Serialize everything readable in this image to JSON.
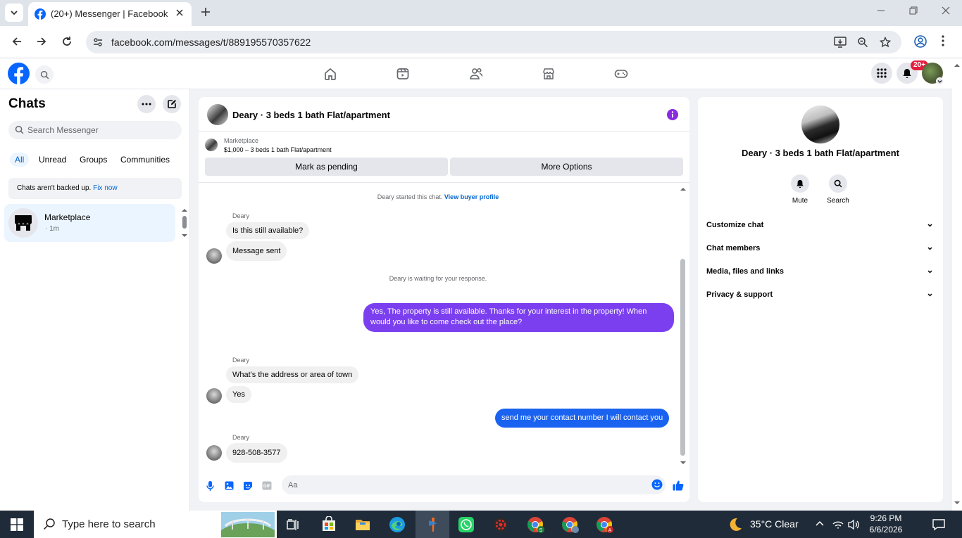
{
  "browser": {
    "tab_title": "(20+) Messenger | Facebook",
    "url": "facebook.com/messages/t/889195570357622"
  },
  "fbnav": {
    "notifications_badge": "20+"
  },
  "sidebar": {
    "title": "Chats",
    "search_placeholder": "Search Messenger",
    "filters": [
      "All",
      "Unread",
      "Groups",
      "Communities"
    ],
    "backup_notice": "Chats aren't backed up.",
    "backup_link": "Fix now",
    "chats": [
      {
        "name": "Marketplace",
        "meta": "· 1m"
      }
    ]
  },
  "conversation": {
    "title": "Deary · 3 beds 1 bath Flat/apartment",
    "marketplace_label": "Marketplace",
    "listing": "$1,000 – 3 beds 1 bath Flat/apartment",
    "mark_pending": "Mark as pending",
    "more_options": "More Options",
    "started_text": "Deary started this chat.",
    "buyer_profile_link": "View buyer profile",
    "waiting_text": "Deary is waiting for your response.",
    "sender_name": "Deary",
    "messages": {
      "in_1": "Is this still available?",
      "in_2": "Message sent",
      "out_1": "Yes, The property is still available. Thanks for your interest in the property! When would you like to come check out the place?",
      "in_3": "What's the address or area of town",
      "in_4": "Yes",
      "out_2": "send me your contact number I will contact you",
      "in_5": "928-508-3577"
    },
    "composer_placeholder": "Aa",
    "accent_color": "#7b3ff0"
  },
  "details": {
    "name": "Deary · 3 beds 1 bath Flat/apartment",
    "actions": [
      "Mute",
      "Search"
    ],
    "sections": [
      "Customize chat",
      "Chat members",
      "Media, files and links",
      "Privacy & support"
    ]
  },
  "taskbar": {
    "search_placeholder": "Type here to search",
    "weather": "35°C  Clear",
    "time": "9:26 PM",
    "date": "6/6/2026"
  }
}
